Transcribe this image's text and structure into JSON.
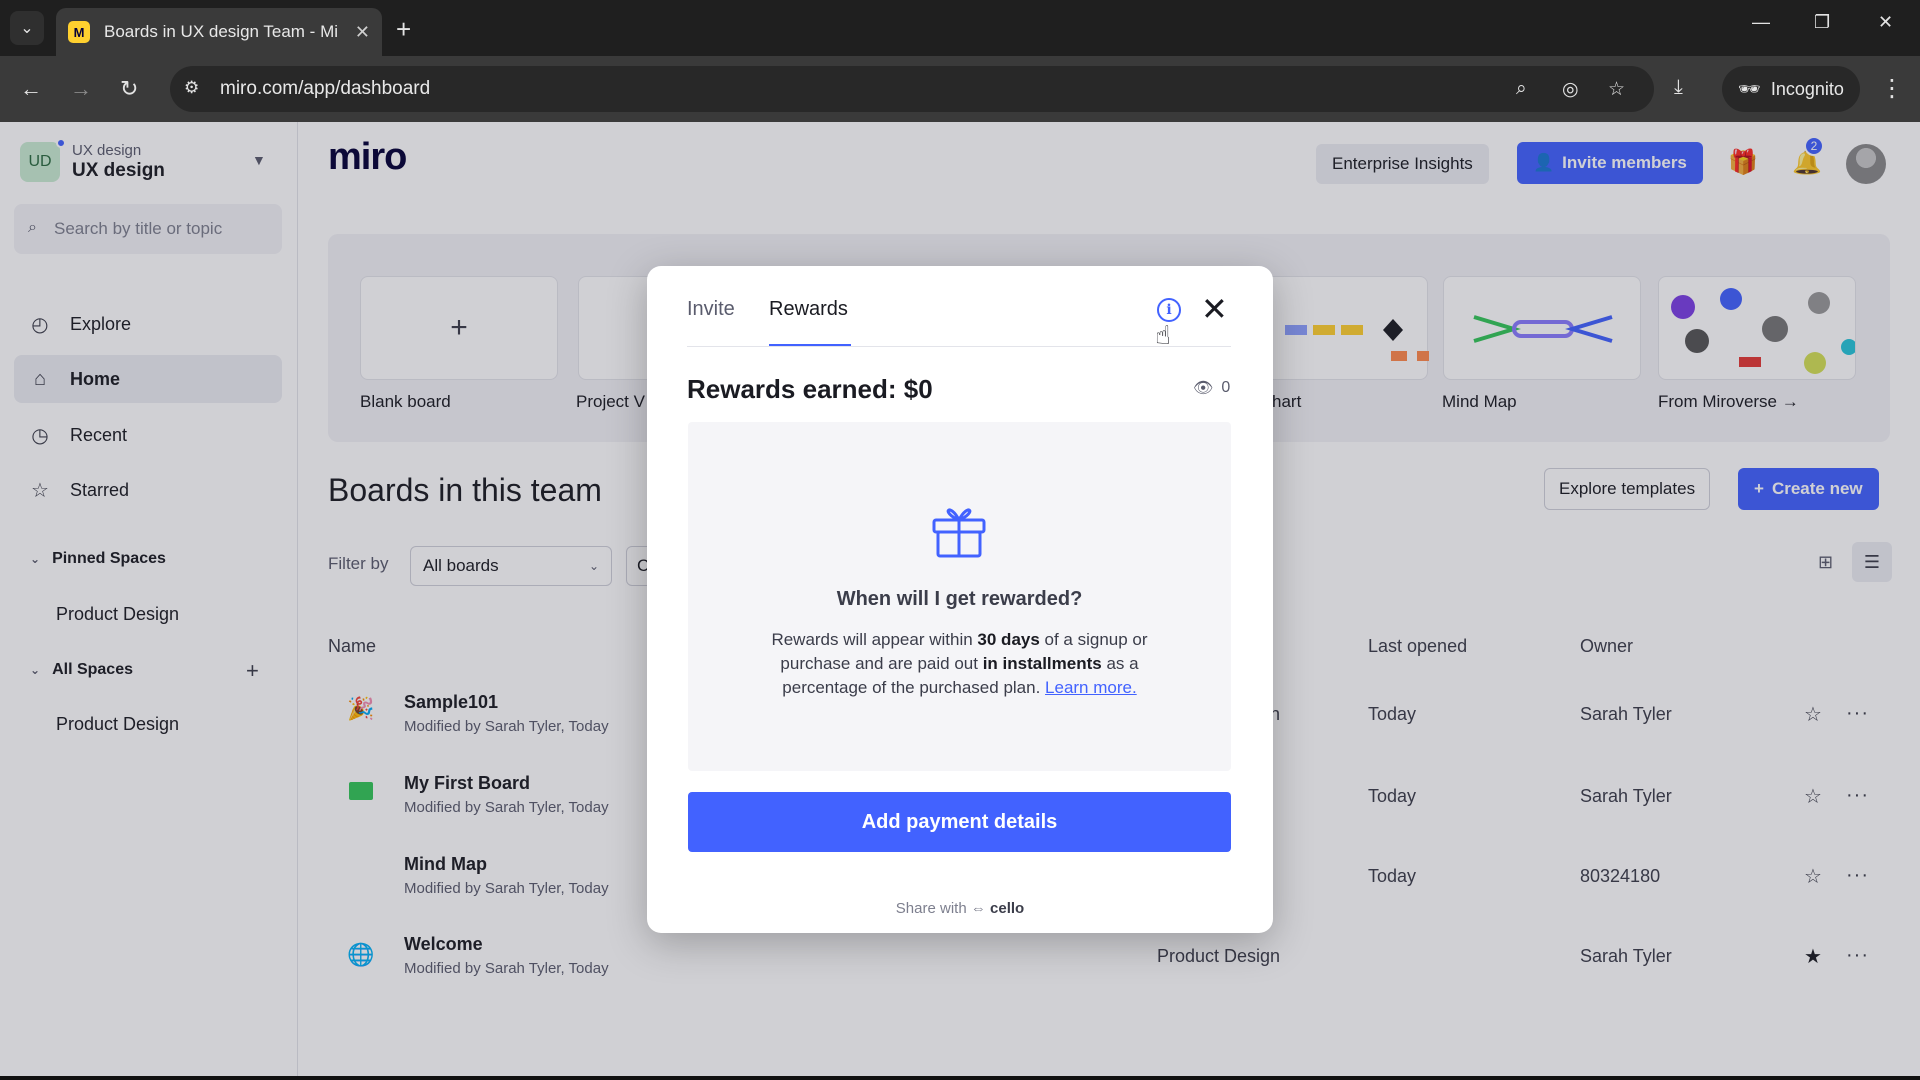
{
  "browser": {
    "tab_title": "Boards in UX design Team - Mi",
    "url": "miro.com/app/dashboard",
    "incognito_label": "Incognito",
    "favicon_letter": "M"
  },
  "sidebar": {
    "team_initials": "UD",
    "team_subtitle": "UX design",
    "team_name": "UX design",
    "search_placeholder": "Search by title or topic",
    "nav": [
      {
        "label": "Explore",
        "icon": "compass-icon"
      },
      {
        "label": "Home",
        "icon": "home-icon"
      },
      {
        "label": "Recent",
        "icon": "clock-icon"
      },
      {
        "label": "Starred",
        "icon": "star-icon"
      }
    ],
    "pinned_header": "Pinned Spaces",
    "pinned_items": [
      "Product Design"
    ],
    "all_header": "All Spaces",
    "all_items": [
      "Product Design"
    ]
  },
  "header": {
    "logo": "miro",
    "enterprise_label": "Enterprise Insights",
    "invite_label": "Invite members",
    "notification_count": "2"
  },
  "templates": [
    {
      "label": "Blank board"
    },
    {
      "label": "Project V"
    },
    {
      "label": "hart"
    },
    {
      "label": "Mind Map"
    },
    {
      "label": "From Miroverse →"
    }
  ],
  "boards": {
    "title": "Boards in this team",
    "explore_label": "Explore templates",
    "create_label": "Create new",
    "filter_label": "Filter by",
    "filter_value": "All boards",
    "filter2_value": "C",
    "columns": {
      "name": "Name",
      "last_opened": "Last opened",
      "owner": "Owner"
    },
    "rows": [
      {
        "name": "Sample101",
        "modified": "Modified by Sarah Tyler, Today",
        "space": "n",
        "opened": "Today",
        "owner": "Sarah Tyler",
        "starred": false
      },
      {
        "name": "My First Board",
        "modified": "Modified by Sarah Tyler, Today",
        "space": "",
        "opened": "Today",
        "owner": "Sarah Tyler",
        "starred": false
      },
      {
        "name": "Mind Map",
        "modified": "Modified by Sarah Tyler, Today",
        "space": "",
        "opened": "Today",
        "owner": "80324180",
        "starred": false
      },
      {
        "name": "Welcome",
        "modified": "Modified by Sarah Tyler, Today",
        "space": "Product Design",
        "opened": "",
        "owner": "Sarah Tyler",
        "starred": true
      }
    ]
  },
  "modal": {
    "tab_invite": "Invite",
    "tab_rewards": "Rewards",
    "rewards_earned": "Rewards earned: $0",
    "views_count": "0",
    "panel_title": "When will I get rewarded?",
    "panel_text_1": "Rewards will appear within ",
    "panel_bold_1": "30 days",
    "panel_text_2": " of a signup or purchase and are paid out ",
    "panel_bold_2": "in installments",
    "panel_text_3": " as a percentage of the purchased plan. ",
    "learn_more": "Learn more.",
    "pay_button": "Add payment details",
    "share_with": "Share with",
    "share_brand": "cello"
  },
  "colors": {
    "accent": "#4262ff",
    "overlay": "rgba(40,42,60,0.22)"
  }
}
